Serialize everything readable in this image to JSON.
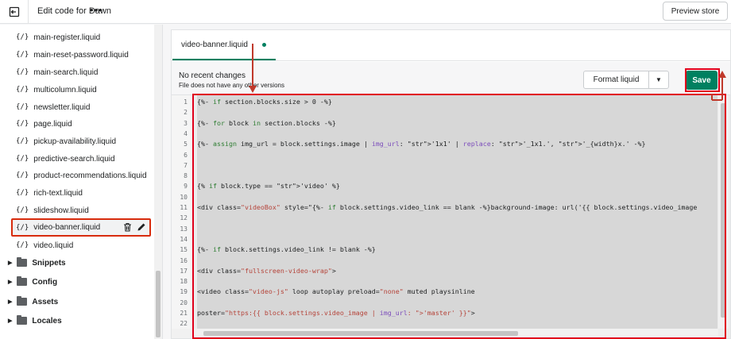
{
  "topbar": {
    "title": "Edit code for Dawn",
    "more": "•••",
    "preview_label": "Preview store"
  },
  "sidebar": {
    "file_icon": "{/}",
    "files": [
      {
        "name": "main-register.liquid"
      },
      {
        "name": "main-reset-password.liquid"
      },
      {
        "name": "main-search.liquid"
      },
      {
        "name": "multicolumn.liquid"
      },
      {
        "name": "newsletter.liquid"
      },
      {
        "name": "page.liquid"
      },
      {
        "name": "pickup-availability.liquid"
      },
      {
        "name": "predictive-search.liquid"
      },
      {
        "name": "product-recommendations.liquid"
      },
      {
        "name": "rich-text.liquid"
      },
      {
        "name": "slideshow.liquid"
      },
      {
        "name": "video-banner.liquid",
        "active": true
      },
      {
        "name": "video.liquid"
      }
    ],
    "folders": [
      {
        "name": "Snippets"
      },
      {
        "name": "Config"
      },
      {
        "name": "Assets"
      },
      {
        "name": "Locales"
      }
    ]
  },
  "editor": {
    "tab_label": "video-banner.liquid",
    "status_title": "No recent changes",
    "status_subtitle": "File does not have any other versions",
    "format_label": "Format liquid",
    "save_label": "Save",
    "line_numbers": [
      "1",
      "2",
      "3",
      "4",
      "5",
      "6",
      "7",
      "8",
      "9",
      "10",
      "11",
      "12",
      "13",
      "14",
      "15",
      "16",
      "17",
      "18",
      "19",
      "20",
      "21",
      "22"
    ],
    "lines": [
      "{%- if section.blocks.size > 0 -%}",
      "",
      "{%- for block in section.blocks -%}",
      "",
      "{%- assign img_url = block.settings.image | img_url: '1x1' | replace: '_1x1.', '_{width}x.' -%}",
      "",
      "",
      "",
      "{% if block.type == 'video' %}",
      "",
      "<div class=\"videoBox\" style=\"{%- if block.settings.video_link == blank -%}background-image: url('{{ block.settings.video_image",
      "",
      "",
      "",
      "{%- if block.settings.video_link != blank -%}",
      "",
      "<div class=\"fullscreen-video-wrap\">",
      "",
      "<video class=\"video-js\" loop autoplay preload=\"none\" muted playsinline",
      "",
      "poster=\"https:{{ block.settings.video_image | img_url: 'master' }}\">",
      ""
    ]
  },
  "colors": {
    "accent": "#008060",
    "annotation": "#e0001b"
  }
}
